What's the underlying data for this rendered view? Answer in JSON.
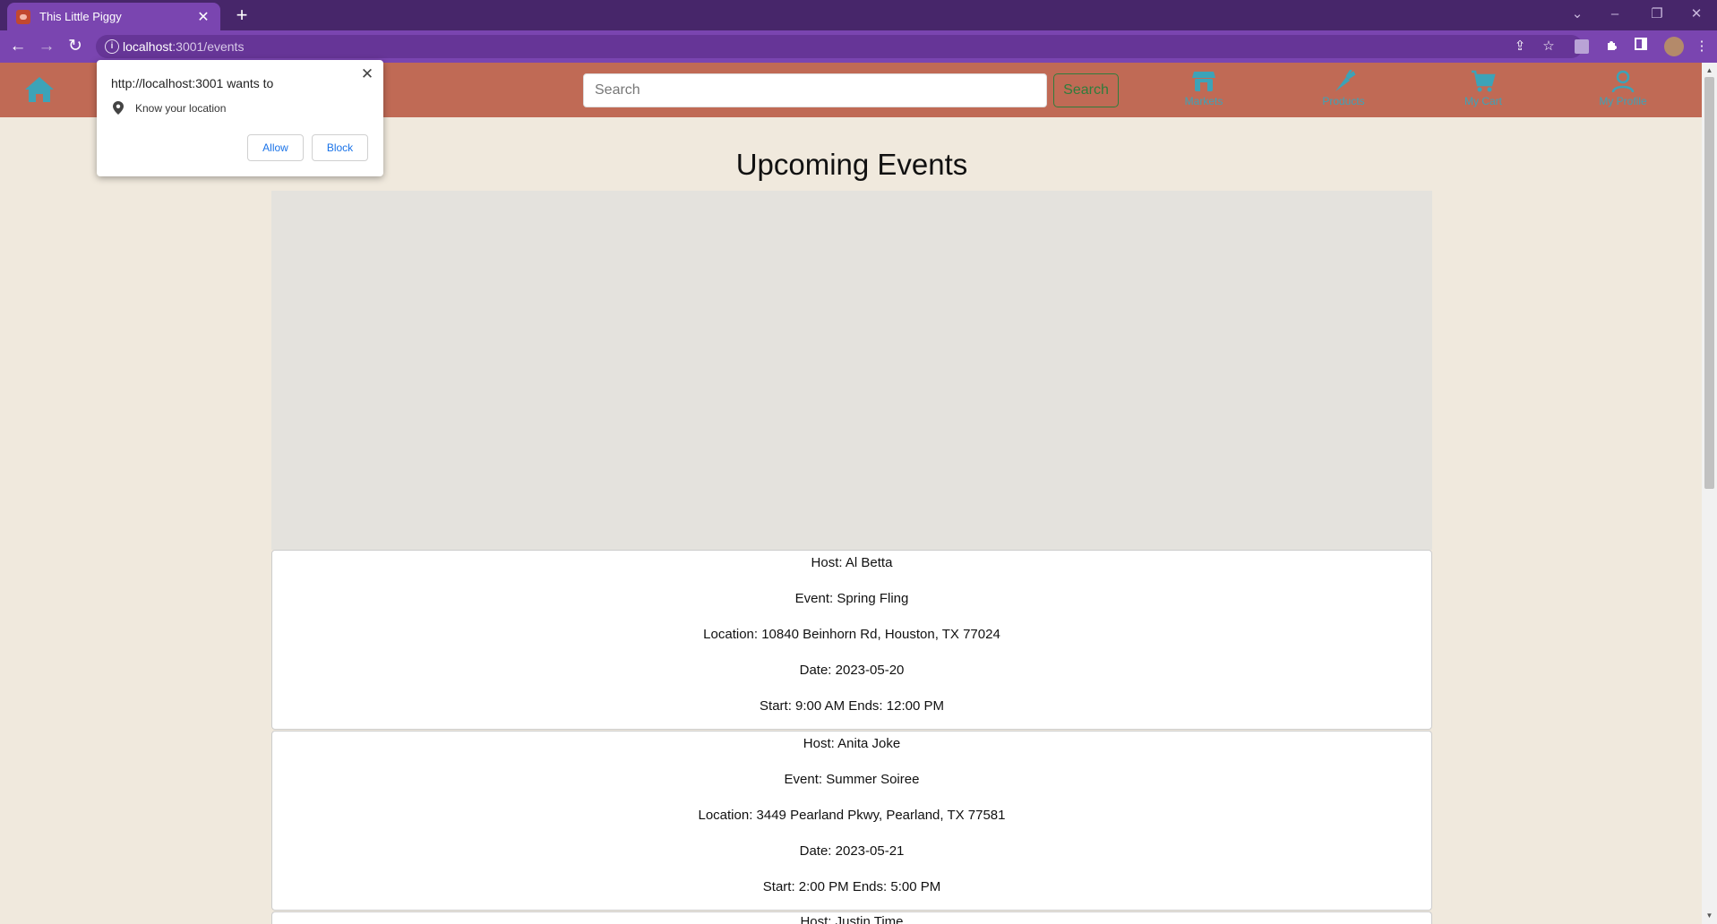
{
  "browser": {
    "tab_title": "This Little Piggy",
    "tab_close": "✕",
    "new_tab": "+",
    "url_host": "localhost",
    "url_path": ":3001/events"
  },
  "header": {
    "search_placeholder": "Search",
    "search_button": "Search",
    "nav": [
      {
        "label": "Markets",
        "icon": "market-icon"
      },
      {
        "label": "Products",
        "icon": "carrot-icon"
      },
      {
        "label": "My Cart",
        "icon": "cart-icon"
      },
      {
        "label": "My Profile",
        "icon": "profile-icon"
      }
    ]
  },
  "page": {
    "title": "Upcoming Events"
  },
  "events": [
    {
      "host": "Host: Al Betta",
      "event": "Event: Spring Fling",
      "location": "Location: 10840 Beinhorn Rd, Houston, TX 77024",
      "date": "Date: 2023-05-20",
      "time": "Start: 9:00 AM Ends: 12:00 PM"
    },
    {
      "host": "Host: Anita Joke",
      "event": "Event: Summer Soiree",
      "location": "Location: 3449 Pearland Pkwy, Pearland, TX 77581",
      "date": "Date: 2023-05-21",
      "time": "Start: 2:00 PM Ends: 5:00 PM"
    },
    {
      "host": "Host: Justin Time"
    }
  ],
  "permission_popup": {
    "title": "http://localhost:3001 wants to",
    "permission": "Know your location",
    "allow": "Allow",
    "block": "Block",
    "close": "✕"
  },
  "colors": {
    "header_bg": "#c06a55",
    "page_bg": "#f0e9dd",
    "nav_icon": "#3ca3b8",
    "search_button": "#2e7d3c",
    "browser_frame": "#47266a",
    "browser_toolbar": "#7a45b0"
  }
}
